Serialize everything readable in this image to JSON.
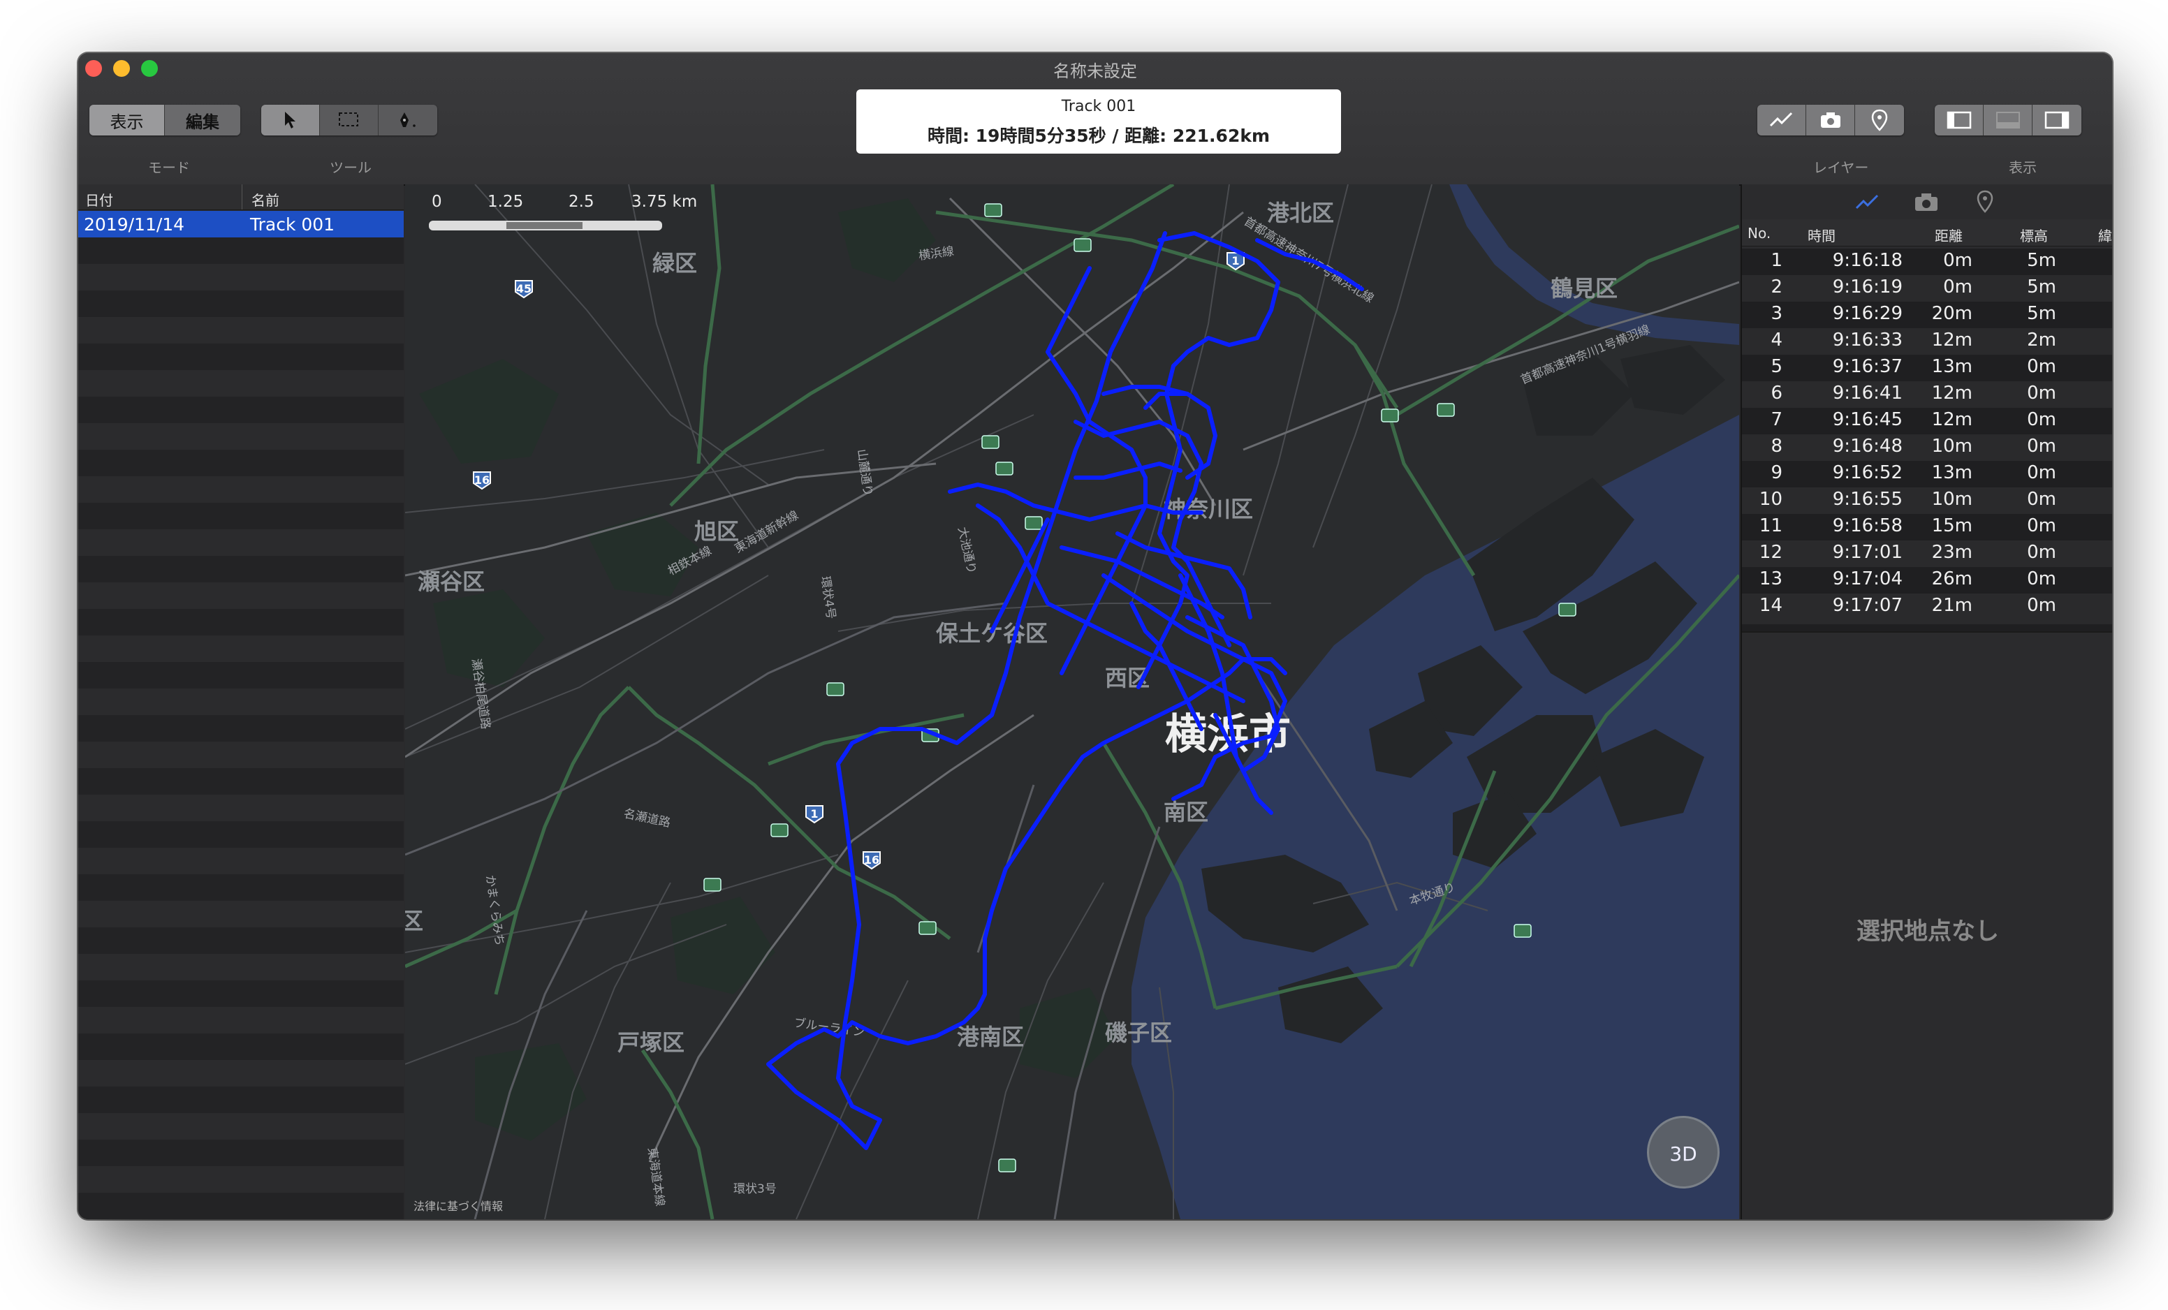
{
  "window": {
    "title": "名称未設定"
  },
  "toolbar": {
    "mode_buttons": [
      "表示",
      "編集"
    ],
    "mode_caption": "モード",
    "tool_caption": "ツール",
    "layer_caption": "レイヤー",
    "view_caption": "表示"
  },
  "info": {
    "track_name": "Track 001",
    "summary": "時間: 19時間5分35秒  /  距離: 221.62km"
  },
  "track_list": {
    "columns": [
      "日付",
      "名前"
    ],
    "rows": [
      {
        "date": "2019/11/14",
        "name": "Track 001"
      }
    ]
  },
  "map": {
    "scale_labels": [
      "0",
      "1.25",
      "2.5",
      "3.75 km"
    ],
    "places": [
      "港北区",
      "鶴見区",
      "緑区",
      "旭区",
      "瀬谷区",
      "保土ケ谷区",
      "神奈川区",
      "西区",
      "横浜市",
      "南区",
      "戸塚区",
      "港南区",
      "磯子区",
      "区"
    ],
    "road_labels": [
      "横浜線",
      "山麓通り",
      "相鉄本線",
      "大池通り",
      "東海道新幹線",
      "環状4号",
      "瀬谷柏尾道路",
      "名瀬道路",
      "本牧通り",
      "かまくらみち",
      "ブルーライン",
      "環状3号",
      "首都高速神奈川1号横羽線",
      "首都高速神奈川7号横浜北線",
      "東海道本線"
    ],
    "route_shields": [
      "45",
      "16",
      "1",
      "16",
      "1"
    ],
    "attribution": "法律に基づく情報",
    "compass_label": "3D",
    "track_color": "#0a1fff"
  },
  "points_table": {
    "columns": [
      "No.",
      "時間",
      "距離",
      "標高",
      "緯"
    ],
    "rows": [
      {
        "no": "1",
        "time": "9:16:18",
        "dist": "0m",
        "elev": "5m"
      },
      {
        "no": "2",
        "time": "9:16:19",
        "dist": "0m",
        "elev": "5m"
      },
      {
        "no": "3",
        "time": "9:16:29",
        "dist": "20m",
        "elev": "5m"
      },
      {
        "no": "4",
        "time": "9:16:33",
        "dist": "12m",
        "elev": "2m"
      },
      {
        "no": "5",
        "time": "9:16:37",
        "dist": "13m",
        "elev": "0m"
      },
      {
        "no": "6",
        "time": "9:16:41",
        "dist": "12m",
        "elev": "0m"
      },
      {
        "no": "7",
        "time": "9:16:45",
        "dist": "12m",
        "elev": "0m"
      },
      {
        "no": "8",
        "time": "9:16:48",
        "dist": "10m",
        "elev": "0m"
      },
      {
        "no": "9",
        "time": "9:16:52",
        "dist": "13m",
        "elev": "0m"
      },
      {
        "no": "10",
        "time": "9:16:55",
        "dist": "10m",
        "elev": "0m"
      },
      {
        "no": "11",
        "time": "9:16:58",
        "dist": "15m",
        "elev": "0m"
      },
      {
        "no": "12",
        "time": "9:17:01",
        "dist": "23m",
        "elev": "0m"
      },
      {
        "no": "13",
        "time": "9:17:04",
        "dist": "26m",
        "elev": "0m"
      },
      {
        "no": "14",
        "time": "9:17:07",
        "dist": "21m",
        "elev": "0m"
      }
    ],
    "empty_message": "選択地点なし"
  },
  "colors": {
    "selection": "#1d4fc4",
    "water": "#2e3a5c",
    "land": "#2a2c2e"
  }
}
